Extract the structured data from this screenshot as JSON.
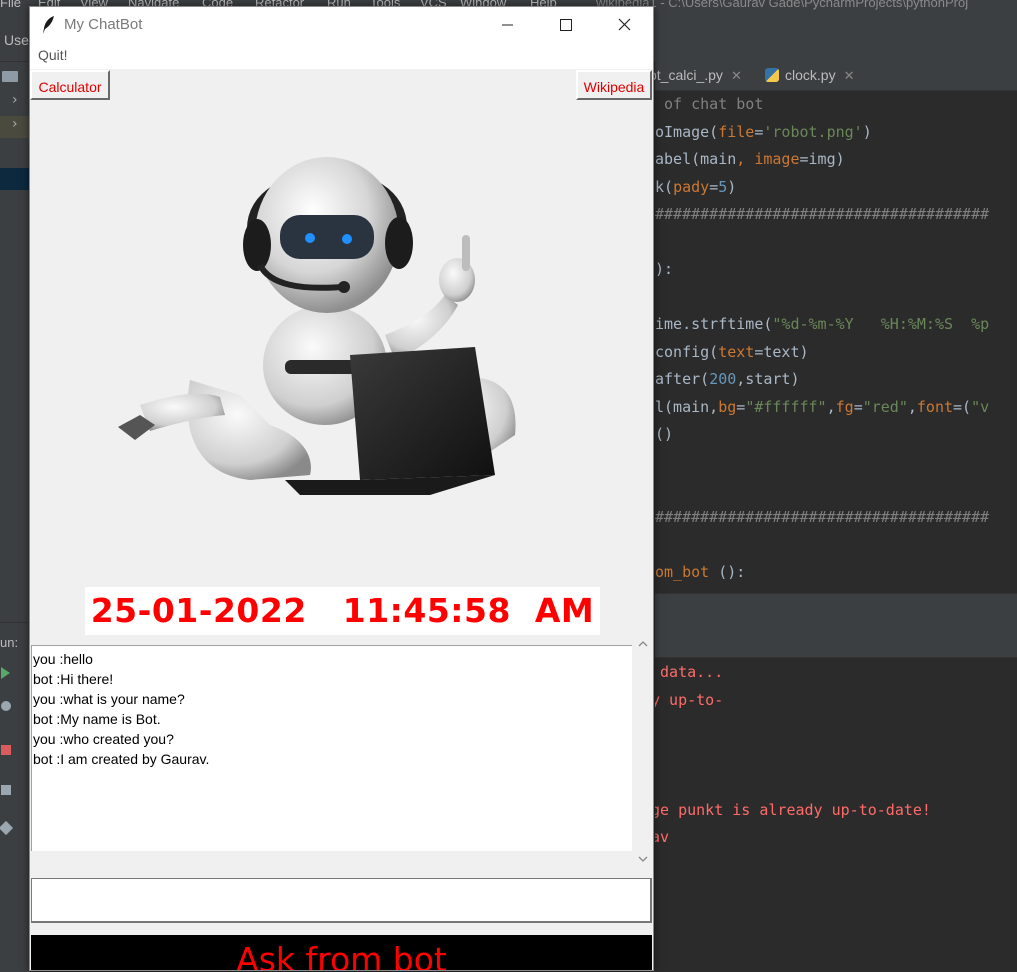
{
  "ide": {
    "menu": [
      "File",
      "Edit",
      "View",
      "Navigate",
      "Code",
      "Refactor",
      "Run",
      "Tools",
      "VCS",
      "Window",
      "Help"
    ],
    "window_path": "wikipedia1 - C:\\Users\\Gaurav Gade\\PycharmProjects\\pythonProj",
    "toolbar_text": "Use",
    "run_label": "un:",
    "tabs": [
      {
        "label": "ot_calci_.py",
        "close": "✕"
      },
      {
        "label": "clock.py",
        "close": "✕"
      }
    ],
    "code_lines": [
      [
        {
          "t": " of chat bot",
          "c": "cm"
        }
      ],
      [
        {
          "t": "oImage(",
          "c": ""
        },
        {
          "t": "file",
          "c": "kw"
        },
        {
          "t": "=",
          "c": ""
        },
        {
          "t": "'robot.png'",
          "c": "str"
        },
        {
          "t": ")",
          "c": ""
        }
      ],
      [
        {
          "t": "abel(main",
          "c": ""
        },
        {
          "t": ", ",
          "c": "kw"
        },
        {
          "t": "image",
          "c": "kw"
        },
        {
          "t": "=img)",
          "c": ""
        }
      ],
      [
        {
          "t": "k(",
          "c": ""
        },
        {
          "t": "pady",
          "c": "kw"
        },
        {
          "t": "=",
          "c": ""
        },
        {
          "t": "5",
          "c": "num"
        },
        {
          "t": ")",
          "c": ""
        }
      ],
      [
        {
          "t": "#####################################",
          "c": "cm"
        }
      ],
      [
        {
          "t": "",
          "c": ""
        }
      ],
      [
        {
          "t": "):",
          "c": ""
        }
      ],
      [
        {
          "t": "",
          "c": ""
        }
      ],
      [
        {
          "t": "ime.strftime(",
          "c": ""
        },
        {
          "t": "\"%d-%m-%Y   %H:%M:%S  %p",
          "c": "str"
        }
      ],
      [
        {
          "t": "config(",
          "c": ""
        },
        {
          "t": "text",
          "c": "kw"
        },
        {
          "t": "=text)",
          "c": ""
        }
      ],
      [
        {
          "t": "after(",
          "c": ""
        },
        {
          "t": "200",
          "c": "num"
        },
        {
          "t": ",start)",
          "c": ""
        }
      ],
      [
        {
          "t": "l(main,",
          "c": ""
        },
        {
          "t": "bg",
          "c": "kw"
        },
        {
          "t": "=",
          "c": ""
        },
        {
          "t": "\"#ffffff\"",
          "c": "str"
        },
        {
          "t": ",",
          "c": ""
        },
        {
          "t": "fg",
          "c": "kw"
        },
        {
          "t": "=",
          "c": ""
        },
        {
          "t": "\"red\"",
          "c": "str"
        },
        {
          "t": ",",
          "c": ""
        },
        {
          "t": "font",
          "c": "kw"
        },
        {
          "t": "=(",
          "c": ""
        },
        {
          "t": "\"v",
          "c": "str"
        }
      ],
      [
        {
          "t": "()",
          "c": ""
        }
      ],
      [
        {
          "t": "",
          "c": ""
        }
      ],
      [
        {
          "t": "",
          "c": ""
        }
      ],
      [
        {
          "t": "#####################################",
          "c": "cm"
        }
      ],
      [
        {
          "t": "",
          "c": ""
        }
      ],
      [
        {
          "t": "om_bot",
          "c": "kw"
        },
        {
          "t": " ():",
          "c": ""
        }
      ]
    ],
    "console_lines": [
      " data...",
      "y up-to-",
      "",
      "",
      "",
      "ge punkt is already up-to-date!",
      "av"
    ]
  },
  "window": {
    "title": "My ChatBot",
    "menu_quit": "Quit!",
    "calculator_label": "Calculator",
    "wikipedia_label": "Wikipedia",
    "clock_text": "25-01-2022   11:45:58  AM",
    "chat_lines": [
      "you :hello",
      "bot :Hi there!",
      "you :what is your name?",
      "bot :My name is Bot.",
      "you :who created you?",
      "bot :I am created by Gaurav."
    ],
    "entry_value": "",
    "ask_label": "Ask from bot"
  },
  "colors": {
    "button_text": "#e00000",
    "clock_text": "#ff0000",
    "ask_bg": "#000000",
    "ask_text": "#ff0000",
    "ide_bg": "#2b2b2b"
  }
}
